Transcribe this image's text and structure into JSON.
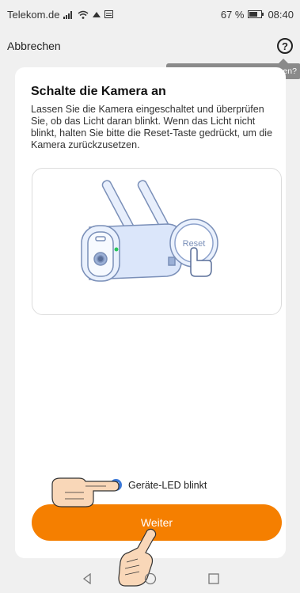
{
  "statusbar": {
    "carrier": "Telekom.de",
    "battery": "67 %",
    "time": "08:40"
  },
  "appbar": {
    "cancel": "Abbrechen",
    "help_icon": "help-circle-icon"
  },
  "tooltip": "Sie können das Licht nicht sehen?",
  "card": {
    "title": "Schalte die Kamera an",
    "description": "Lassen Sie die Kamera eingeschaltet und überprüfen Sie, ob das Licht daran blinkt. Wenn das Licht nicht blinkt, halten Sie bitte die Reset-Taste gedrückt, um die Kamera zurückzusetzen.",
    "illustration_button": "Reset"
  },
  "checkbox": {
    "label": "Geräte-LED blinkt",
    "checked": true
  },
  "primary_button": "Weiter",
  "colors": {
    "accent": "#f57f00",
    "checkbox": "#3a78d8",
    "tooltip": "#8a8a8a"
  }
}
